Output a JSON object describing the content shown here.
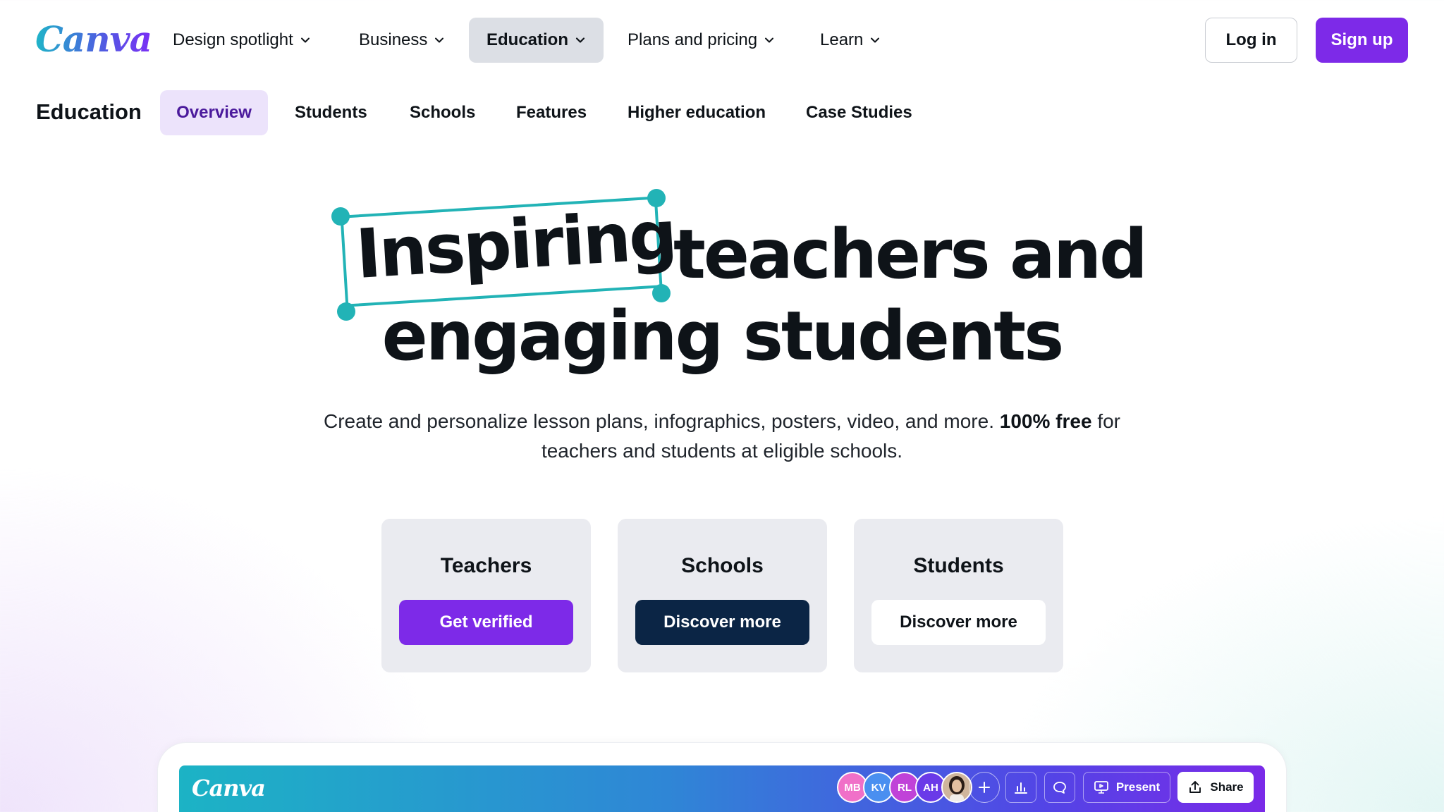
{
  "brand": {
    "logo": "Canva"
  },
  "nav": {
    "items": [
      {
        "label": "Design spotlight"
      },
      {
        "label": "Business"
      },
      {
        "label": "Education"
      },
      {
        "label": "Plans and pricing"
      },
      {
        "label": "Learn"
      }
    ],
    "active": "Education",
    "login_label": "Log in",
    "signup_label": "Sign up"
  },
  "subnav": {
    "title": "Education",
    "tabs": [
      {
        "label": "Overview"
      },
      {
        "label": "Students"
      },
      {
        "label": "Schools"
      },
      {
        "label": "Features"
      },
      {
        "label": "Higher education"
      },
      {
        "label": "Case Studies"
      }
    ],
    "active": "Overview"
  },
  "hero": {
    "word_highlighted": "Inspiring",
    "line1_rest": "teachers and",
    "line2": "engaging students",
    "subtitle_part1": "Create and personalize lesson plans, infographics, posters, video, and more.",
    "subtitle_bold": "100% free",
    "subtitle_part2": "for",
    "subtitle_line2": "teachers and students at eligible schools."
  },
  "cards": [
    {
      "title": "Teachers",
      "button": "Get verified"
    },
    {
      "title": "Schools",
      "button": "Discover more"
    },
    {
      "title": "Students",
      "button": "Discover more"
    }
  ],
  "editor_preview": {
    "logo": "Canva",
    "avatars": [
      {
        "initials": "MB",
        "color": "#f070c8"
      },
      {
        "initials": "KV",
        "color": "#4a8ff0"
      },
      {
        "initials": "RL",
        "color": "#c042d8"
      },
      {
        "initials": "AH",
        "color": "#6a3ae8"
      }
    ],
    "present_label": "Present",
    "share_label": "Share"
  },
  "colors": {
    "brand_purple": "#7d2ae8",
    "navy": "#0b2545",
    "teal_accent": "#22b3b6"
  }
}
